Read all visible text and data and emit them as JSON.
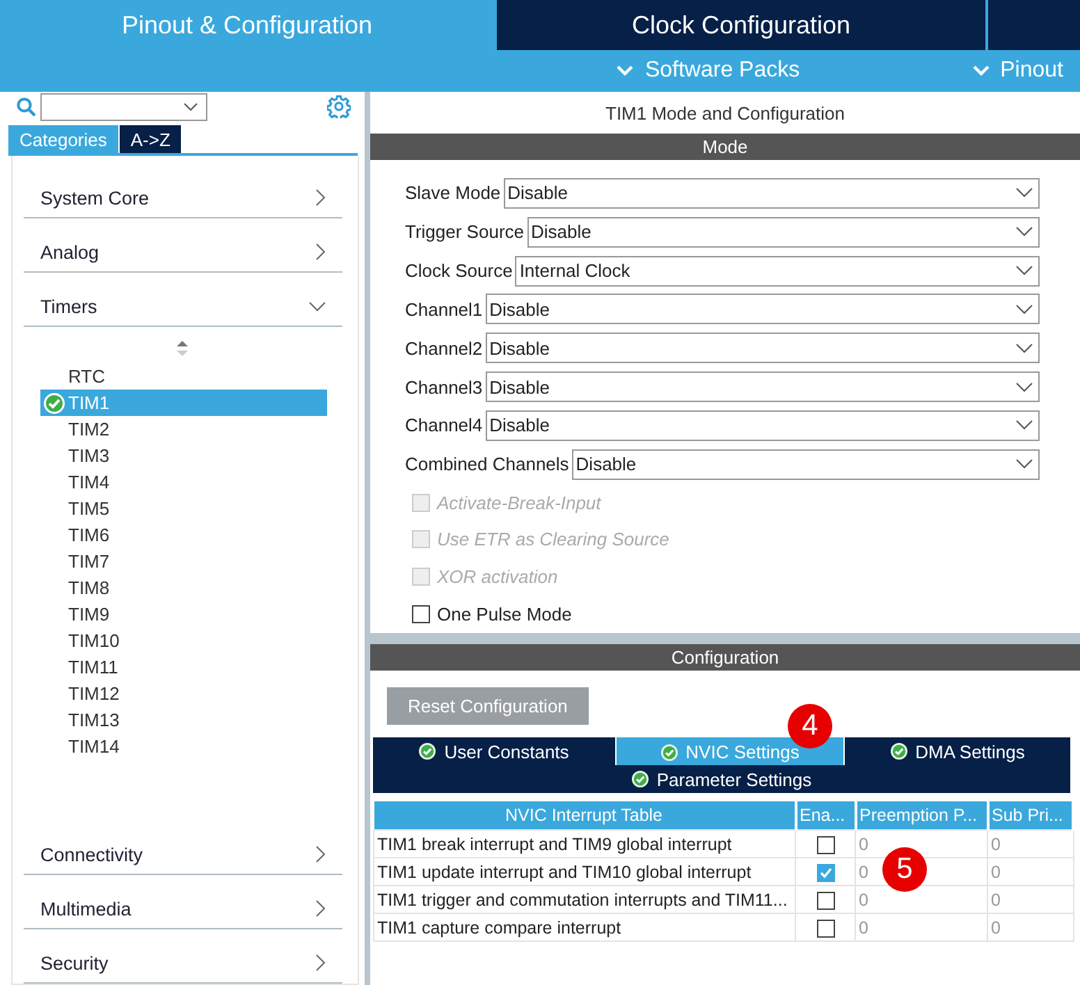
{
  "tabs": [
    {
      "label": "Pinout & Configuration",
      "selected": true
    },
    {
      "label": "Clock Configuration",
      "selected": false
    }
  ],
  "sub_menus": [
    {
      "label": "Software Packs"
    },
    {
      "label": "Pinout"
    }
  ],
  "sidebar": {
    "view_tabs": [
      {
        "label": "Categories",
        "selected": true
      },
      {
        "label": "A->Z",
        "selected": false
      }
    ],
    "categories": [
      {
        "label": "System Core",
        "expanded": false
      },
      {
        "label": "Analog",
        "expanded": false
      },
      {
        "label": "Timers",
        "expanded": true,
        "children": [
          {
            "label": "RTC",
            "selected": false,
            "configured": false
          },
          {
            "label": "TIM1",
            "selected": true,
            "configured": true
          },
          {
            "label": "TIM2",
            "selected": false,
            "configured": false
          },
          {
            "label": "TIM3",
            "selected": false,
            "configured": false
          },
          {
            "label": "TIM4",
            "selected": false,
            "configured": false
          },
          {
            "label": "TIM5",
            "selected": false,
            "configured": false
          },
          {
            "label": "TIM6",
            "selected": false,
            "configured": false
          },
          {
            "label": "TIM7",
            "selected": false,
            "configured": false
          },
          {
            "label": "TIM8",
            "selected": false,
            "configured": false
          },
          {
            "label": "TIM9",
            "selected": false,
            "configured": false
          },
          {
            "label": "TIM10",
            "selected": false,
            "configured": false
          },
          {
            "label": "TIM11",
            "selected": false,
            "configured": false
          },
          {
            "label": "TIM12",
            "selected": false,
            "configured": false
          },
          {
            "label": "TIM13",
            "selected": false,
            "configured": false
          },
          {
            "label": "TIM14",
            "selected": false,
            "configured": false
          }
        ]
      },
      {
        "label": "Connectivity",
        "expanded": false
      },
      {
        "label": "Multimedia",
        "expanded": false
      },
      {
        "label": "Security",
        "expanded": false
      }
    ]
  },
  "panel_title": "TIM1 Mode and Configuration",
  "mode": {
    "title": "Mode",
    "fields": [
      {
        "label": "Slave Mode",
        "value": "Disable"
      },
      {
        "label": "Trigger Source",
        "value": "Disable"
      },
      {
        "label": "Clock Source",
        "value": "Internal Clock"
      },
      {
        "label": "Channel1",
        "value": "Disable"
      },
      {
        "label": "Channel2",
        "value": "Disable"
      },
      {
        "label": "Channel3",
        "value": "Disable"
      },
      {
        "label": "Channel4",
        "value": "Disable"
      },
      {
        "label": "Combined Channels",
        "value": "Disable"
      }
    ],
    "options": [
      {
        "label": "Activate-Break-Input",
        "checked": false,
        "disabled": true
      },
      {
        "label": "Use ETR as Clearing Source",
        "checked": false,
        "disabled": true
      },
      {
        "label": "XOR activation",
        "checked": false,
        "disabled": true
      },
      {
        "label": "One Pulse Mode",
        "checked": false,
        "disabled": false
      }
    ]
  },
  "configuration": {
    "title": "Configuration",
    "reset_button": "Reset Configuration",
    "tabs": [
      {
        "label": "User Constants",
        "selected": false
      },
      {
        "label": "NVIC Settings",
        "selected": true
      },
      {
        "label": "DMA Settings",
        "selected": false
      },
      {
        "label": "Parameter Settings",
        "selected": false
      }
    ],
    "table": {
      "columns": [
        "NVIC Interrupt Table",
        "Ena...",
        "Preemption P...",
        "Sub Pri..."
      ],
      "rows": [
        {
          "name": "TIM1 break interrupt and TIM9 global interrupt",
          "checked": false,
          "preemption": "0",
          "sub": "0"
        },
        {
          "name": "TIM1 update interrupt and TIM10 global interrupt",
          "checked": true,
          "preemption": "0",
          "sub": "0"
        },
        {
          "name": "TIM1 trigger and commutation interrupts and TIM11...",
          "checked": false,
          "preemption": "0",
          "sub": "0"
        },
        {
          "name": "TIM1 capture compare interrupt",
          "checked": false,
          "preemption": "0",
          "sub": "0"
        }
      ]
    }
  },
  "annotations": [
    {
      "label": "4"
    },
    {
      "label": "5"
    }
  ]
}
